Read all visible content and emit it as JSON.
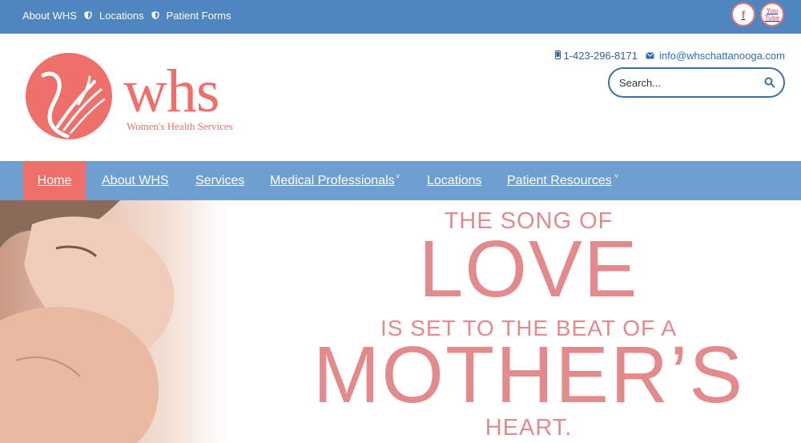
{
  "topbar": {
    "links": [
      {
        "label": "About WHS"
      },
      {
        "label": "Locations"
      },
      {
        "label": "Patient Forms"
      }
    ],
    "social": {
      "facebook_glyph": "f",
      "youtube_glyph": "You\nTube"
    }
  },
  "header": {
    "logo_word": "whs",
    "logo_tagline": "Women's Health Services",
    "phone": "1-423-296-8171",
    "email": "info@whschattanooga.com",
    "search_placeholder": "Search..."
  },
  "nav": {
    "items": [
      {
        "label": "Home",
        "active": true
      },
      {
        "label": "About WHS"
      },
      {
        "label": "Services"
      },
      {
        "label": "Medical Professionals",
        "has_dropdown": true
      },
      {
        "label": "Locations"
      },
      {
        "label": "Patient Resources",
        "has_dropdown": true
      }
    ]
  },
  "hero": {
    "line1": "THE SONG OF",
    "line2": "LOVE",
    "line3": "IS SET TO THE BEAT OF A",
    "line4": "MOTHER’S",
    "line5": "HEART."
  },
  "colors": {
    "topbar": "#4f85c1",
    "nav": "#6f9ed1",
    "accent": "#ef6f6a",
    "hero_text": "#e38a8d"
  }
}
